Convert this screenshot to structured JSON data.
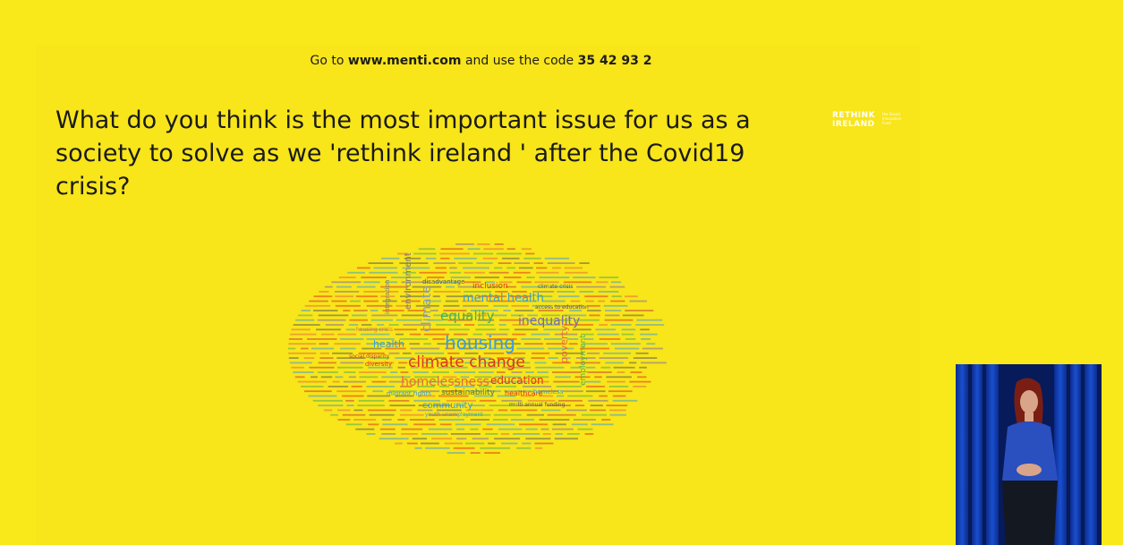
{
  "slide": {
    "code_prefix": "Go to ",
    "code_url": "www.menti.com",
    "code_middle": " and use the code ",
    "code_value": "35 42 93 2",
    "question": "What do you think is the most important issue for us as a society to solve as we 'rethink ireland ' after the Covid19 crisis?"
  },
  "logo": {
    "line1": "RETHINK",
    "line2": "IRELAND",
    "tagline": "the Social Innovation Fund"
  },
  "word_cloud": {
    "words": [
      {
        "text": "climate change",
        "color": "#e0341a",
        "size": 17
      },
      {
        "text": "housing",
        "color": "#3a9be0",
        "size": 20
      },
      {
        "text": "equality",
        "color": "#4caf50",
        "size": 15
      },
      {
        "text": "mental health",
        "color": "#3aa0c8",
        "size": 13
      },
      {
        "text": "inequality",
        "color": "#7b6aa8",
        "size": 14
      },
      {
        "text": "homelessness",
        "color": "#e86a3a",
        "size": 14
      },
      {
        "text": "education",
        "color": "#e0341a",
        "size": 12
      },
      {
        "text": "health",
        "color": "#3aa0c8",
        "size": 11
      },
      {
        "text": "climate",
        "color": "#8aa0b0",
        "size": 14
      },
      {
        "text": "environment",
        "color": "#7a7a7a",
        "size": 10
      },
      {
        "text": "poverty",
        "color": "#e86a3a",
        "size": 11
      },
      {
        "text": "employment",
        "color": "#4caf50",
        "size": 9
      },
      {
        "text": "community",
        "color": "#3a9be0",
        "size": 10
      },
      {
        "text": "sustainability",
        "color": "#5a7a3a",
        "size": 9
      },
      {
        "text": "inclusion",
        "color": "#e0341a",
        "size": 9
      },
      {
        "text": "healthcare",
        "color": "#e0341a",
        "size": 8
      },
      {
        "text": "homeless",
        "color": "#3aa0c8",
        "size": 7
      },
      {
        "text": "migrant rights",
        "color": "#3a9be0",
        "size": 7
      },
      {
        "text": "diversity",
        "color": "#e0341a",
        "size": 7
      },
      {
        "text": "social disparity",
        "color": "#c83a3a",
        "size": 6
      },
      {
        "text": "housing crisis",
        "color": "#e86a3a",
        "size": 6
      },
      {
        "text": "disadvantage",
        "color": "#5a5a5a",
        "size": 7
      },
      {
        "text": "climate crisis",
        "color": "#5a5a5a",
        "size": 6
      },
      {
        "text": "access to education",
        "color": "#5a5a5a",
        "size": 6
      },
      {
        "text": "youth unemployment",
        "color": "#3aa0c8",
        "size": 6
      },
      {
        "text": "multi annual funding",
        "color": "#5a5a5a",
        "size": 6
      },
      {
        "text": "integration",
        "color": "#7a7a7a",
        "size": 7
      }
    ]
  },
  "colors": {
    "background": "#f9e91a",
    "text": "#1a1a1a"
  }
}
